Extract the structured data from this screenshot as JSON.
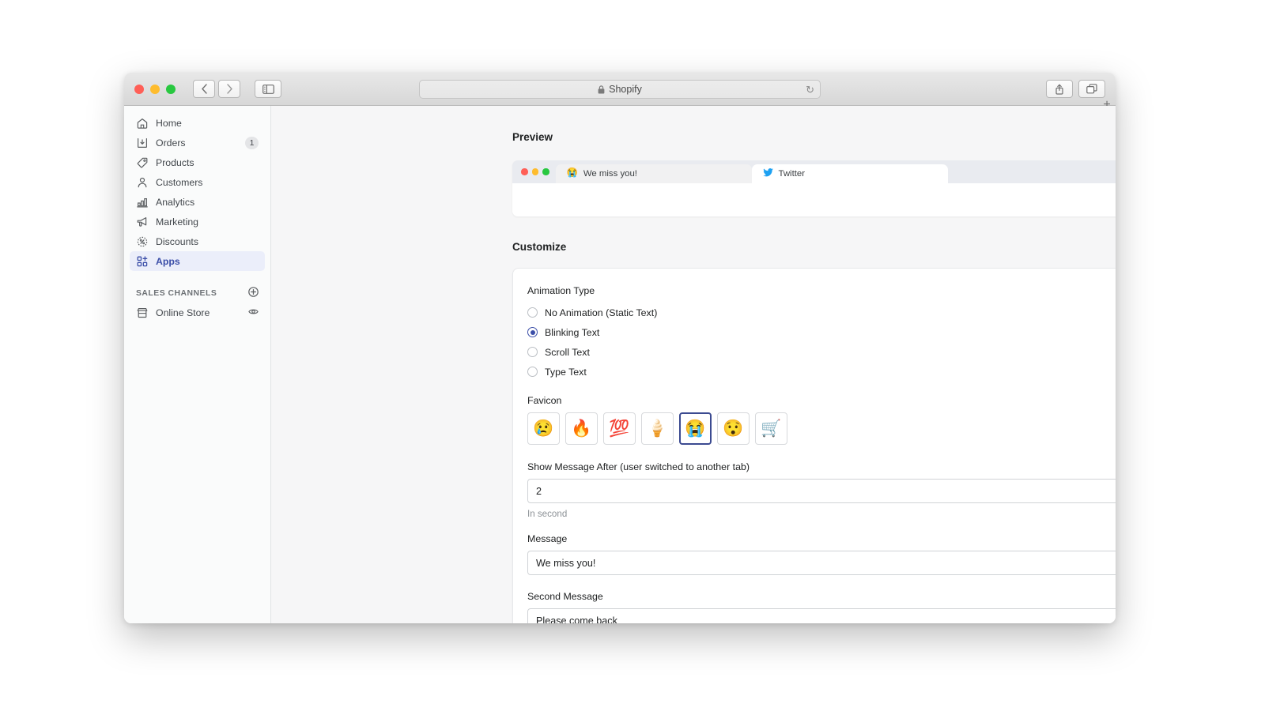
{
  "browser": {
    "traffic_lights": [
      "close",
      "minimize",
      "maximize"
    ],
    "back_label": "‹",
    "forward_label": "›",
    "sidebar_toggle_name": "sidebar-toggle-icon",
    "address": {
      "lock": "🔒",
      "url_text": "Shopify",
      "reload_glyph": "↻"
    },
    "share_glyph": "⇧",
    "tabs_overview_name": "tab-overview-icon",
    "new_tab_glyph": "+"
  },
  "sidebar": {
    "items": [
      {
        "label": "Home",
        "icon": "home-icon",
        "badge": ""
      },
      {
        "label": "Orders",
        "icon": "orders-icon",
        "badge": "1"
      },
      {
        "label": "Products",
        "icon": "products-icon",
        "badge": ""
      },
      {
        "label": "Customers",
        "icon": "customers-icon",
        "badge": ""
      },
      {
        "label": "Analytics",
        "icon": "analytics-icon",
        "badge": ""
      },
      {
        "label": "Marketing",
        "icon": "marketing-icon",
        "badge": ""
      },
      {
        "label": "Discounts",
        "icon": "discounts-icon",
        "badge": ""
      },
      {
        "label": "Apps",
        "icon": "apps-icon",
        "badge": ""
      }
    ],
    "section": {
      "title": "SALES CHANNELS",
      "add_icon": "plus-circle-icon"
    },
    "channels": [
      {
        "label": "Online Store",
        "icon": "store-icon",
        "action_icon": "eye-icon"
      }
    ]
  },
  "main": {
    "preview": {
      "title": "Preview",
      "tabs": [
        {
          "favicon": "😭",
          "label": "We miss you!",
          "active": false
        },
        {
          "favicon": "🐦",
          "label": "Twitter",
          "active": true
        }
      ]
    },
    "customize": {
      "title": "Customize",
      "animation": {
        "label": "Animation Type",
        "options": [
          {
            "label": "No Animation (Static Text)",
            "selected": false
          },
          {
            "label": "Blinking Text",
            "selected": true
          },
          {
            "label": "Scroll Text",
            "selected": false
          },
          {
            "label": "Type Text",
            "selected": false
          }
        ]
      },
      "favicon": {
        "label": "Favicon",
        "options": [
          {
            "emoji": "😢",
            "name": "crying-face",
            "selected": false
          },
          {
            "emoji": "🔥",
            "name": "fire",
            "selected": false
          },
          {
            "emoji": "💯",
            "name": "hundred-points",
            "selected": false
          },
          {
            "emoji": "🍦",
            "name": "soft-ice-cream",
            "selected": false
          },
          {
            "emoji": "😭",
            "name": "loudly-crying-face",
            "selected": true
          },
          {
            "emoji": "😯",
            "name": "hushed-face",
            "selected": false
          },
          {
            "emoji": "🛒",
            "name": "shopping-cart",
            "selected": false
          }
        ]
      },
      "delay": {
        "label": "Show Message After (user switched to another tab)",
        "value": "2",
        "help": "In second",
        "spinner_up": "▲",
        "spinner_down": "▼"
      },
      "message": {
        "label": "Message",
        "value": "We miss you!"
      },
      "second_message": {
        "label": "Second Message",
        "value": "Please come back"
      }
    }
  }
}
